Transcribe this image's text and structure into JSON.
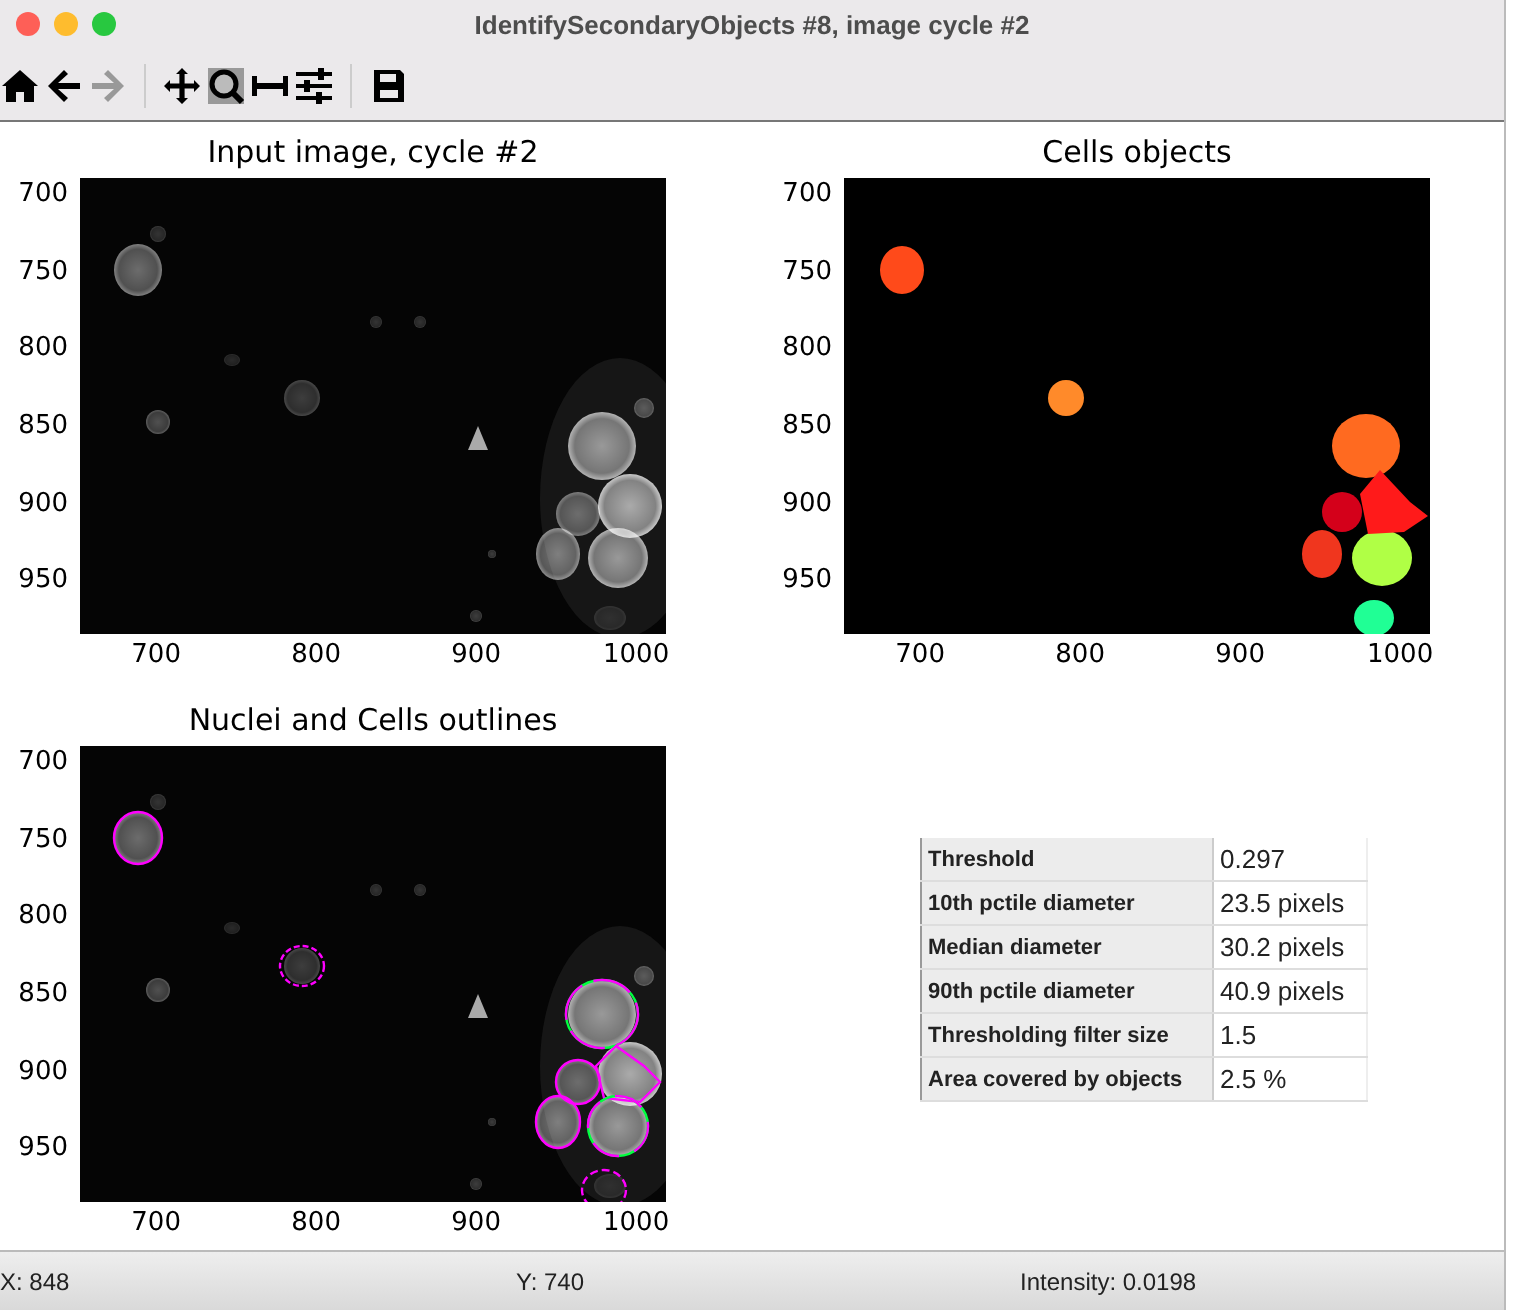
{
  "window": {
    "title": "IdentifySecondaryObjects #8, image cycle #2"
  },
  "toolbar": [
    {
      "kind": "home",
      "disabled": false
    },
    {
      "kind": "back",
      "disabled": false
    },
    {
      "kind": "forward",
      "disabled": true
    },
    {
      "kind": "separator"
    },
    {
      "kind": "pan",
      "disabled": false
    },
    {
      "kind": "zoom",
      "disabled": false
    },
    {
      "kind": "subplots",
      "disabled": false
    },
    {
      "kind": "configure",
      "disabled": false
    },
    {
      "kind": "separator"
    },
    {
      "kind": "save",
      "disabled": false
    }
  ],
  "panels": [
    {
      "kind": "image",
      "title": "Input image, cycle #2",
      "yticks": [
        "700",
        "750",
        "800",
        "850",
        "900",
        "950"
      ],
      "xticks": [
        "700",
        "800",
        "900",
        "1000"
      ]
    },
    {
      "kind": "labels",
      "title": "Cells objects",
      "yticks": [
        "700",
        "750",
        "800",
        "850",
        "900",
        "950"
      ],
      "xticks": [
        "700",
        "800",
        "900",
        "1000"
      ]
    },
    {
      "kind": "outlines",
      "title": "Nuclei and Cells outlines",
      "yticks": [
        "700",
        "750",
        "800",
        "850",
        "900",
        "950"
      ],
      "xticks": [
        "700",
        "800",
        "900",
        "1000"
      ]
    }
  ],
  "table": {
    "rows": [
      {
        "label": "Threshold",
        "value": "0.297"
      },
      {
        "label": "10th pctile diameter",
        "value": "23.5 pixels"
      },
      {
        "label": "Median diameter",
        "value": "30.2 pixels"
      },
      {
        "label": "90th pctile diameter",
        "value": "40.9 pixels"
      },
      {
        "label": "Thresholding filter size",
        "value": "1.5"
      },
      {
        "label": "Area covered by objects",
        "value": "2.5 %"
      }
    ]
  },
  "status_bar": {
    "x": "X: 848",
    "y": "Y: 740",
    "intensity": "Intensity: 0.0198"
  }
}
